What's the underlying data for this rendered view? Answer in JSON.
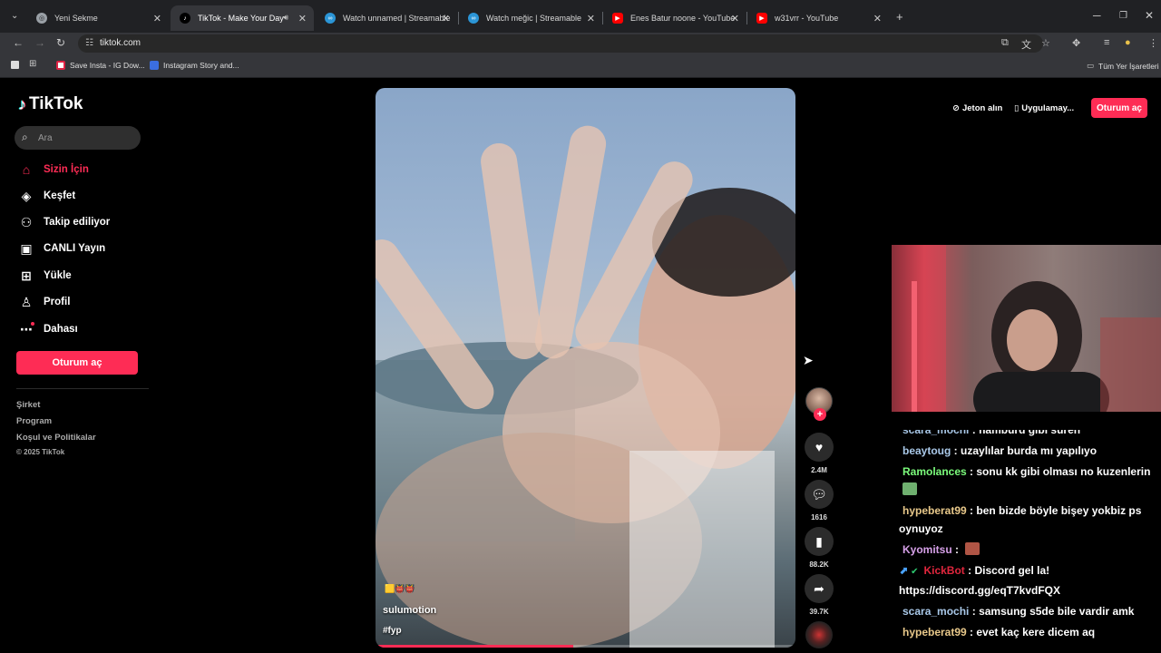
{
  "browser": {
    "tabs": [
      {
        "title": "Yeni Sekme",
        "icon": "chrome-icon"
      },
      {
        "title": "TikTok - Make Your Day",
        "icon": "tiktok-icon",
        "active": true,
        "audio": true
      },
      {
        "title": "Watch unnamed | Streamable",
        "icon": "streamable-icon"
      },
      {
        "title": "Watch meğic | Streamable",
        "icon": "streamable-icon"
      },
      {
        "title": "Enes Batur noone - YouTube",
        "icon": "youtube-icon"
      },
      {
        "title": "w31vrr - YouTube",
        "icon": "youtube-icon"
      }
    ],
    "url": "tiktok.com",
    "bookmarks": [
      {
        "label": "Save Insta - IG Dow..."
      },
      {
        "label": "Instagram Story and..."
      }
    ],
    "all_bookmarks": "Tüm Yer İşaretleri"
  },
  "tiktok": {
    "logo": "TikTok",
    "search_placeholder": "Ara",
    "nav": [
      {
        "label": "Sizin İçin",
        "icon": "home-icon",
        "active": true
      },
      {
        "label": "Keşfet",
        "icon": "compass-icon"
      },
      {
        "label": "Takip ediliyor",
        "icon": "following-icon"
      },
      {
        "label": "CANLI Yayın",
        "icon": "live-icon"
      },
      {
        "label": "Yükle",
        "icon": "upload-icon"
      },
      {
        "label": "Profil",
        "icon": "profile-icon"
      },
      {
        "label": "Dahası",
        "icon": "more-icon"
      }
    ],
    "login_label": "Oturum aç",
    "footer": [
      "Şirket",
      "Program",
      "Koşul ve Politikalar",
      "© 2025 TikTok"
    ],
    "top_buttons": {
      "coins": "Jeton alın",
      "app": "Uygulamay...",
      "login": "Oturum aç"
    },
    "video": {
      "username": "sulumotion",
      "hashtags": "#fyp",
      "progress_fraction": 0.47
    },
    "actions": {
      "likes": "2.4M",
      "comments": "1616",
      "saves": "88.2K",
      "shares": "39.7K"
    }
  },
  "chat": {
    "messages": [
      {
        "user": "scara_mochi",
        "color": "#a9c8e8",
        "text": "hamburd gibi suren"
      },
      {
        "user": "beaytoug",
        "color": "#a9c8e8",
        "text": "uzaylılar burda mı yapılıyo"
      },
      {
        "user": "Ramolances",
        "color": "#7cfc7c",
        "text": "sonu kk gibi olması no kuzenlerin",
        "emote": "#6fb06f"
      },
      {
        "user": "hypeberat99",
        "color": "#e8c88a",
        "text": "ben bizde böyle bişey yokbiz ps oynuyoz"
      },
      {
        "user": "Kyomitsu",
        "color": "#d6a0e8",
        "text": "",
        "emote": "#b05545"
      },
      {
        "user": "KickBot",
        "color": "#e0263d",
        "text": "Discord gel la! https://discord.gg/eqT7kvdFQX",
        "badges": true
      },
      {
        "user": "scara_mochi",
        "color": "#a9c8e8",
        "text": "samsung s5de bile vardir amk"
      },
      {
        "user": "hypeberat99",
        "color": "#e8c88a",
        "text": "evet kaç kere dicem aq"
      }
    ]
  },
  "colors": {
    "accent": "#fe2c55",
    "browser_bg": "#202124",
    "toolbar_bg": "#35363a"
  }
}
